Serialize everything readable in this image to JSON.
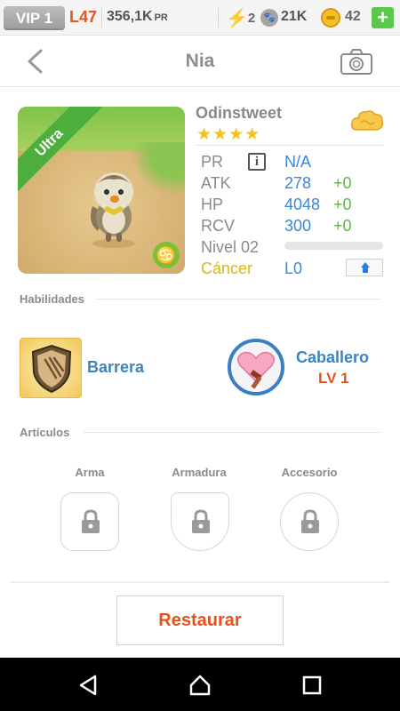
{
  "status_bar": {
    "vip": "VIP 1",
    "level": "L47",
    "pr_value": "356,1K",
    "pr_suffix": "PR",
    "energy": "2",
    "paws": "21K",
    "coins": "42",
    "add": "+"
  },
  "header": {
    "title": "Nia"
  },
  "card": {
    "rarity": "Ultra",
    "zodiac_glyph": "♋"
  },
  "info": {
    "name": "Odinstweet",
    "stars": "★★★★",
    "star_count": 4,
    "pr_label": "PR",
    "info_glyph": "i",
    "pr_value": "N/A",
    "stats": [
      {
        "label": "ATK",
        "value": "278",
        "bonus": "+0"
      },
      {
        "label": "HP",
        "value": "4048",
        "bonus": "+0"
      },
      {
        "label": "RCV",
        "value": "300",
        "bonus": "+0"
      }
    ],
    "level_label": "Nivel 02",
    "level_progress": 0,
    "sign": "Cáncer",
    "rank": "L0"
  },
  "skills": {
    "title": "Habilidades",
    "items": [
      {
        "name": "Barrera"
      },
      {
        "name": "Caballero",
        "level": "LV 1"
      }
    ]
  },
  "items_section": {
    "title": "Artículos",
    "slots": [
      {
        "label": "Arma"
      },
      {
        "label": "Armadura"
      },
      {
        "label": "Accesorio"
      }
    ]
  },
  "actions": {
    "restore": "Restaurar"
  }
}
